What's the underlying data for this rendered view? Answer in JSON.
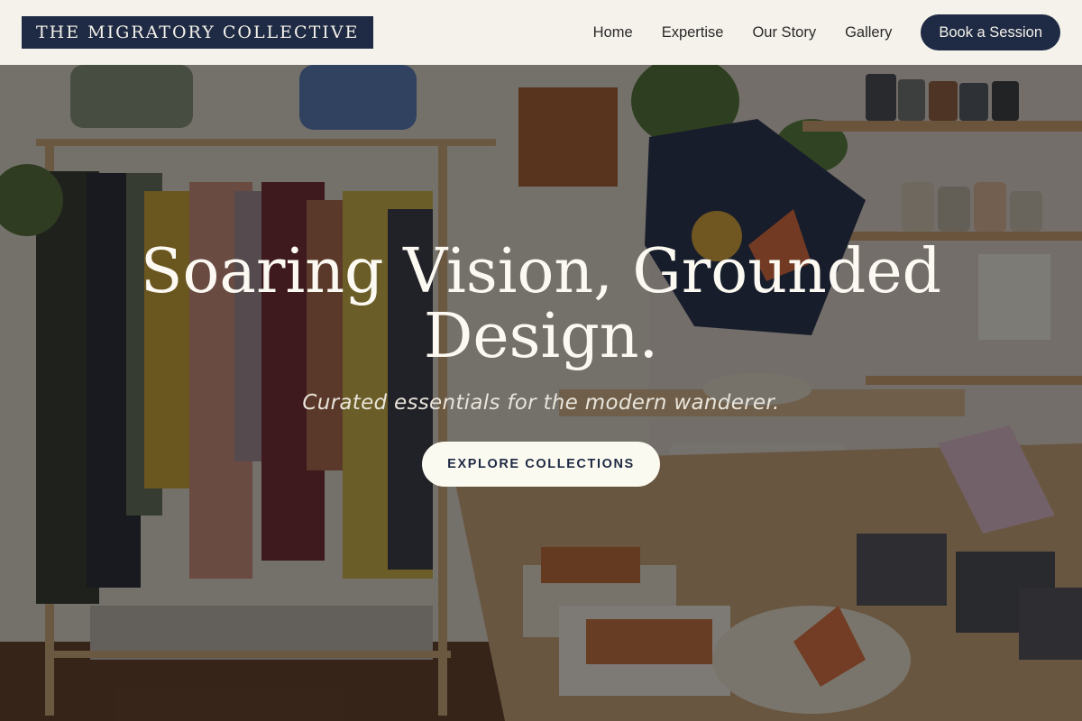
{
  "brand": {
    "logo_text": "THE MIGRATORY COLLECTIVE"
  },
  "nav": {
    "items": [
      {
        "label": "Home"
      },
      {
        "label": "Expertise"
      },
      {
        "label": "Our Story"
      },
      {
        "label": "Gallery"
      }
    ],
    "cta_label": "Book a Session"
  },
  "hero": {
    "title": "Soaring Vision, Grounded Design.",
    "subtitle": "Curated essentials for the modern wanderer.",
    "cta_label": "EXPLORE COLLECTIONS"
  },
  "colors": {
    "navy": "#1f2a44",
    "header_bg": "#f4f2ea",
    "cream": "#fbfaf1"
  }
}
